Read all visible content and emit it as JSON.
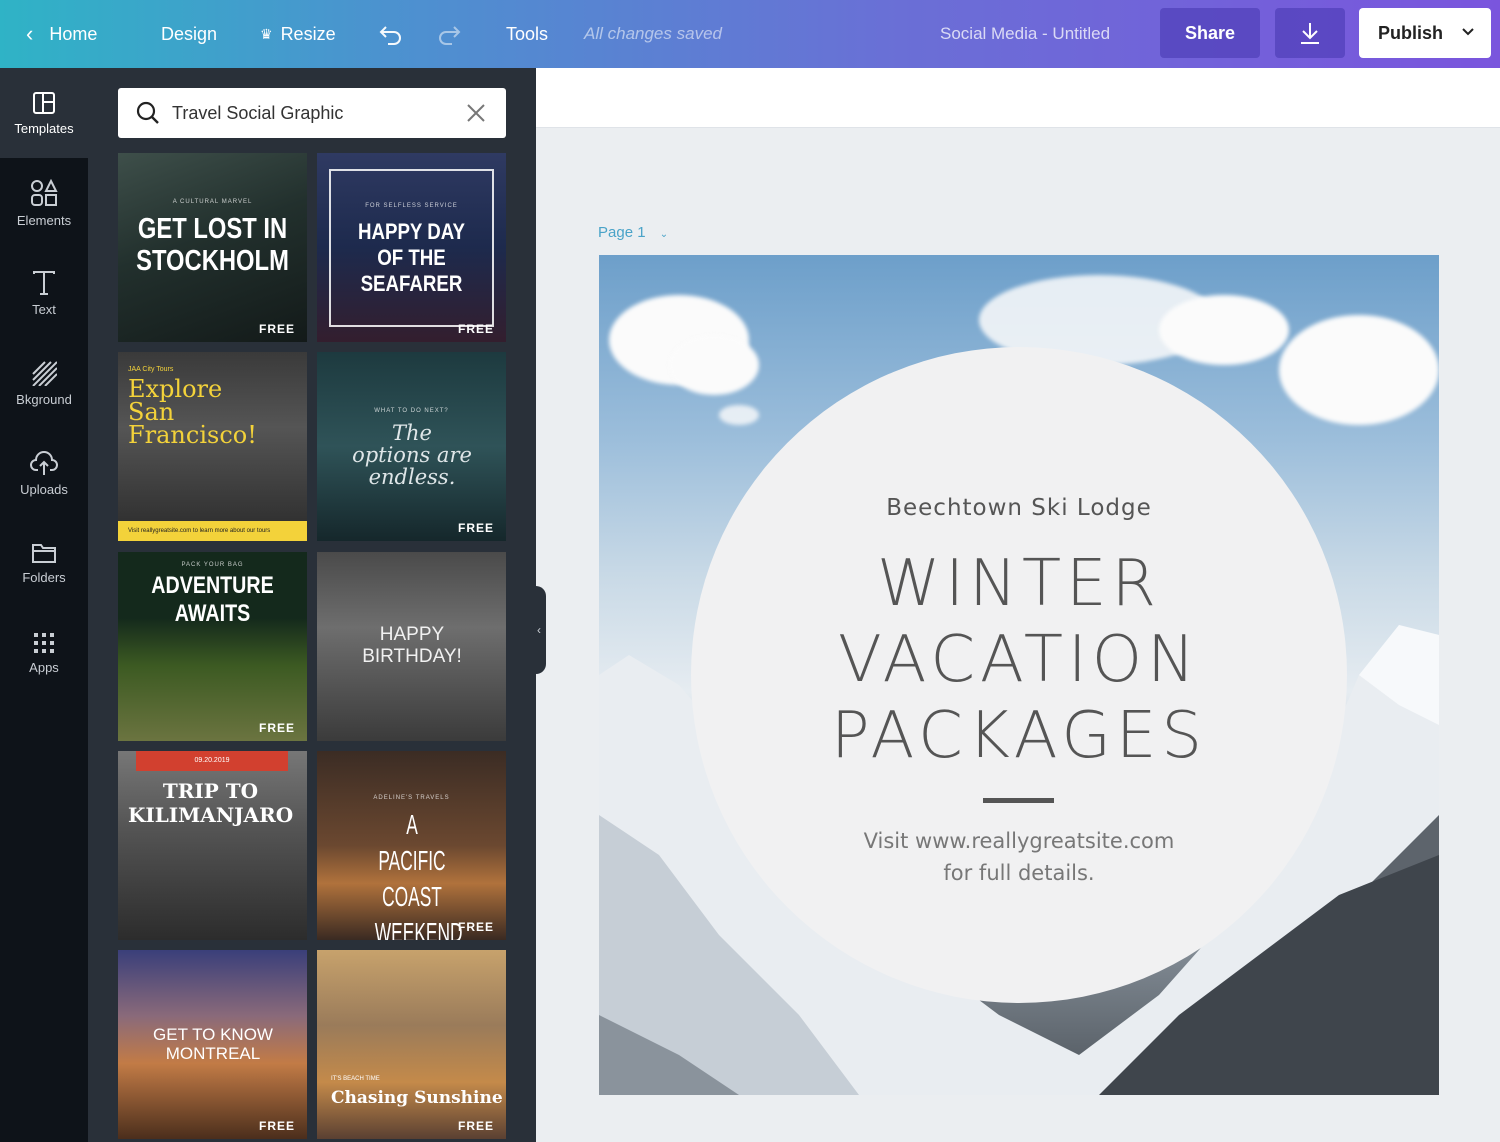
{
  "topbar": {
    "home_label": "Home",
    "design_label": "Design",
    "resize_label": "Resize",
    "tools_label": "Tools",
    "save_status": "All changes saved",
    "document_title": "Social Media - Untitled",
    "share_label": "Share",
    "publish_label": "Publish",
    "undo_icon": "undo-icon",
    "redo_icon": "redo-icon",
    "download_icon": "download-icon"
  },
  "rail": {
    "items": [
      {
        "label": "Templates",
        "icon": "templates-icon"
      },
      {
        "label": "Elements",
        "icon": "elements-icon"
      },
      {
        "label": "Text",
        "icon": "text-icon"
      },
      {
        "label": "Bkground",
        "icon": "background-icon"
      },
      {
        "label": "Uploads",
        "icon": "uploads-icon"
      },
      {
        "label": "Folders",
        "icon": "folders-icon"
      },
      {
        "label": "Apps",
        "icon": "apps-icon"
      }
    ]
  },
  "search": {
    "value": "Travel Social Graphic"
  },
  "templates": [
    {
      "kicker": "A CULTURAL MARVEL",
      "title": "GET LOST IN STOCKHOLM",
      "badge": "FREE"
    },
    {
      "kicker": "FOR SELFLESS SERVICE",
      "title": "HAPPY DAY OF THE SEAFARER",
      "badge": "FREE"
    },
    {
      "kicker": "JAA City Tours",
      "title": "Explore San Francisco!",
      "footer": "Visit reallygreatsite.com to learn more about our tours"
    },
    {
      "kicker": "WHAT TO DO NEXT?",
      "title": "The options are endless.",
      "badge": "FREE"
    },
    {
      "kicker": "PACK YOUR BAG",
      "title": "ADVENTURE AWAITS",
      "badge": "FREE"
    },
    {
      "title": "HAPPY BIRTHDAY!",
      "badge": ""
    },
    {
      "kicker": "09.20.2019",
      "title": "TRIP TO KILIMANJARO",
      "badge": ""
    },
    {
      "kicker": "ADELINE'S TRAVELS",
      "title": "A PACIFIC COAST WEEKEND",
      "badge": "FREE"
    },
    {
      "title": "GET TO KNOW MONTREAL",
      "badge": "FREE"
    },
    {
      "kicker": "IT'S BEACH TIME",
      "title": "Chasing Sunshine",
      "badge": "FREE"
    }
  ],
  "canvas": {
    "page_label": "Page 1",
    "lodge_name": "Beechtown Ski Lodge",
    "headline_lines": [
      "WINTER",
      "VACATION",
      "PACKAGES"
    ],
    "note_lines": [
      "Visit www.reallygreatsite.com",
      "for full details."
    ]
  },
  "colors": {
    "accent_gradient_start": "#2fb3c6",
    "accent_gradient_end": "#7a55dd",
    "panel_bg": "#293039",
    "rail_bg": "#0e1319",
    "page_label": "#4aa3c8"
  }
}
